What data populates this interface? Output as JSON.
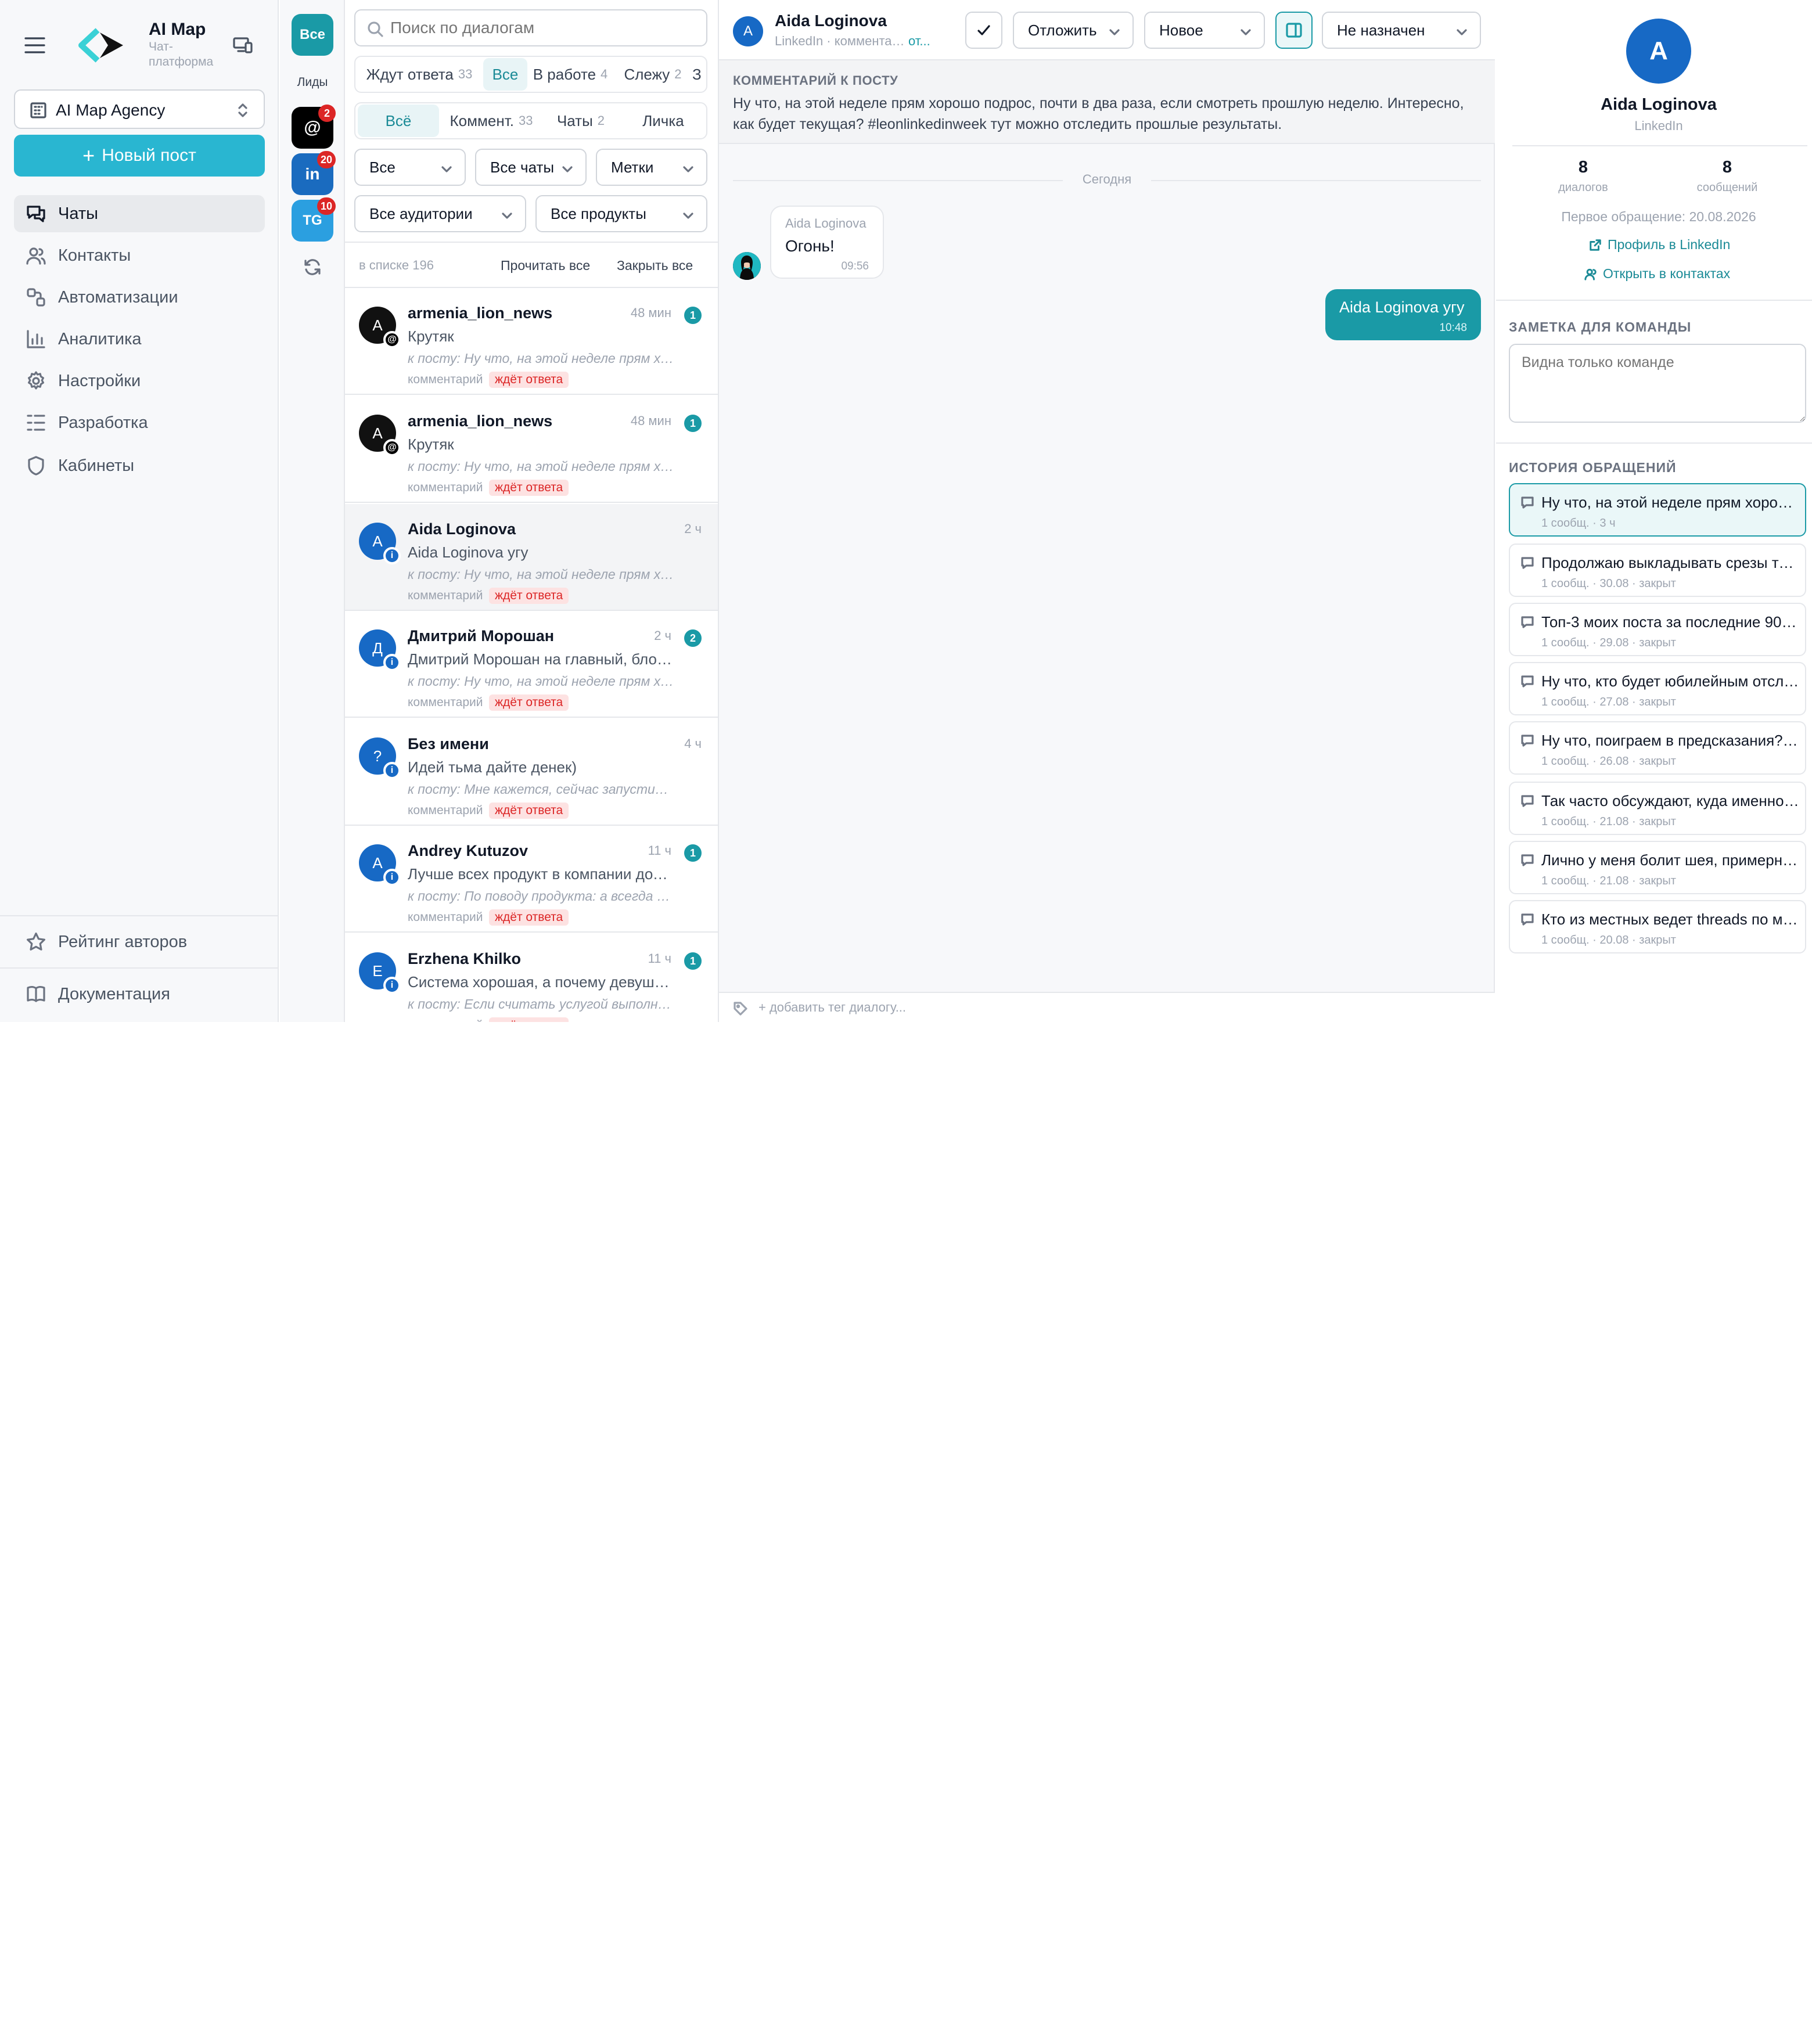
{
  "app": {
    "name": "AI Map",
    "subtitle": "Чат-платформа",
    "workspace": "AI Map Agency",
    "new_post": "Новый пост"
  },
  "nav": [
    {
      "label": "Чаты",
      "icon": "chat-icon",
      "active": true
    },
    {
      "label": "Контакты",
      "icon": "users-icon"
    },
    {
      "label": "Автоматизации",
      "icon": "automation-icon"
    },
    {
      "label": "Аналитика",
      "icon": "analytics-icon"
    },
    {
      "label": "Настройки",
      "icon": "gear-icon"
    },
    {
      "label": "Разработка",
      "icon": "list-icon"
    },
    {
      "label": "Кабинеты",
      "icon": "shield-icon"
    }
  ],
  "nav_bottom": [
    {
      "label": "Рейтинг авторов",
      "icon": "star-icon"
    },
    {
      "label": "Документация",
      "icon": "book-icon"
    }
  ],
  "rail": {
    "all_label": "Все",
    "leads_label": "Лиды",
    "channels": [
      {
        "label": "@",
        "badge": "2",
        "color": "#000000",
        "icon": "threads-icon"
      },
      {
        "label": "in",
        "badge": "20",
        "color": "#1a6bbf",
        "icon": "linkedin-icon"
      },
      {
        "label": "TG",
        "badge": "10",
        "color": "#2b9fe0",
        "icon": "telegram-icon"
      }
    ]
  },
  "list": {
    "search_placeholder": "Поиск по диалогам",
    "status_tabs": [
      {
        "label": "Ждут ответа",
        "count": "33"
      },
      {
        "label": "Все",
        "count": "",
        "active": true
      },
      {
        "label": "В работе",
        "count": "4"
      },
      {
        "label": "Слежу",
        "count": "2"
      },
      {
        "label": "З",
        "count": ""
      }
    ],
    "type_tabs": [
      {
        "label": "Всё",
        "count": "",
        "active": true
      },
      {
        "label": "Коммент.",
        "count": "33"
      },
      {
        "label": "Чаты",
        "count": "2"
      },
      {
        "label": "Личка",
        "count": ""
      }
    ],
    "filters": [
      "Все",
      "Все чаты",
      "Метки",
      "Все аудитории",
      "Все продукты"
    ],
    "count_text": "в списке 196",
    "read_all": "Прочитать все",
    "close_all": "Закрыть все",
    "conversations": [
      {
        "avatar": "A",
        "av_color": "#111111",
        "sub": "@",
        "sub_color": "#000000",
        "name": "armenia_lion_news",
        "time": "48 мин",
        "unread": "1",
        "preview": "Крутяк",
        "post": "к посту: Ну что, на этой неделе прям хорошо подрос",
        "type": "комментарий",
        "status": "ждёт ответа"
      },
      {
        "avatar": "A",
        "av_color": "#111111",
        "sub": "@",
        "sub_color": "#000000",
        "name": "armenia_lion_news",
        "time": "48 мин",
        "unread": "1",
        "preview": "Крутяк",
        "post": "к посту: Ну что, на этой неделе прям хорошо подрос",
        "type": "комментарий",
        "status": "ждёт ответа"
      },
      {
        "avatar": "A",
        "av_color": "#1769c5",
        "sub": "i",
        "sub_color": "#1769c5",
        "name": "Aida Loginova",
        "time": "2 ч",
        "unread": "",
        "preview": "Aida Loginova угу",
        "post": "к посту: Ну что, на этой неделе прям хорошо подрос",
        "type": "комментарий",
        "status": "ждёт ответа",
        "selected": true
      },
      {
        "avatar": "Д",
        "av_color": "#1769c5",
        "sub": "i",
        "sub_color": "#1769c5",
        "name": "Дмитрий Морошан",
        "time": "2 ч",
        "unread": "2",
        "preview": "Дмитрий Морошан на главный, блок с кейсами",
        "post": "к посту: Ну что, на этой неделе прям хорошо подрос",
        "type": "комментарий",
        "status": "ждёт ответа"
      },
      {
        "avatar": "?",
        "av_color": "#1769c5",
        "sub": "i",
        "sub_color": "#1769c5",
        "name": "Без имени",
        "time": "4 ч",
        "unread": "",
        "preview": "Идей тьма дайте денек)",
        "post": "к посту: Мне кажется, сейчас запустить стартап",
        "type": "комментарий",
        "status": "ждёт ответа"
      },
      {
        "avatar": "A",
        "av_color": "#1769c5",
        "sub": "i",
        "sub_color": "#1769c5",
        "name": "Andrey Kutuzov",
        "time": "11 ч",
        "unread": "1",
        "preview": "Лучше всех продукт в компании должен знать",
        "post": "к посту: По поводу продукта: а всегда ли нужно",
        "type": "комментарий",
        "status": "ждёт ответа"
      },
      {
        "avatar": "E",
        "av_color": "#1769c5",
        "sub": "i",
        "sub_color": "#1769c5",
        "name": "Erzhena Khilko",
        "time": "11 ч",
        "unread": "1",
        "preview": "Система хорошая, а почему девушка не может",
        "post": "к посту: Если считать услугой выполнение задач",
        "type": "комментарий",
        "status": "ждёт ответа"
      }
    ]
  },
  "chat": {
    "name": "Aida Loginova",
    "avatar": "A",
    "meta": "LinkedIn · комментарий · от",
    "meta_link": "от...",
    "postpone": "Отложить",
    "status": "Новое",
    "assignee": "Не назначен",
    "post_comment_label": "КОММЕНТАРИЙ К ПОСТУ",
    "post_comment": "Ну что, на этой неделе прям хорошо подрос, почти в два раза, если смотреть прошлую неделю. Интересно, как будет текущая? #leonlinkedinweek тут можно отследить прошлые результаты.",
    "day_divider": "Сегодня",
    "messages": [
      {
        "side": "in",
        "author": "Aida Loginova",
        "text": "Огонь!",
        "time": "09:56"
      },
      {
        "side": "out",
        "author": "",
        "text": "Aida Loginova угу",
        "time": "10:48"
      }
    ],
    "tag_placeholder": "+ добавить тег диалогу..."
  },
  "profile": {
    "avatar": "A",
    "name": "Aida Loginova",
    "source": "LinkedIn",
    "dialogs": "8",
    "dialogs_label": "диалогов",
    "messages": "8",
    "messages_label": "сообщений",
    "first_contact": "Первое обращение: 20.08.2026",
    "linkedin_link": "Профиль в LinkedIn",
    "contacts_link": "Открыть в контактах",
    "note_title": "ЗАМЕТКА ДЛЯ КОМАНДЫ",
    "note_placeholder": "Видна только команде",
    "history_title": "ИСТОРИЯ ОБРАЩЕНИЙ",
    "history": [
      {
        "title": "Ну что, на этой неделе прям хорошо подрос",
        "meta": "1 сообщ. · 3 ч",
        "active": true
      },
      {
        "title": "Продолжаю выкладывать срезы тестов",
        "meta": "1 сообщ. · 30.08 · закрыт"
      },
      {
        "title": "Топ-3 моих поста за последние 90 дней",
        "meta": "1 сообщ. · 29.08 · закрыт"
      },
      {
        "title": "Ну что, кто будет юбилейным отслеживать",
        "meta": "1 сообщ. · 27.08 · закрыт"
      },
      {
        "title": "Ну что, поиграем в предсказания? Кто",
        "meta": "1 сообщ. · 26.08 · закрыт"
      },
      {
        "title": "Так часто обсуждают, куда именно стоит",
        "meta": "1 сообщ. · 21.08 · закрыт"
      },
      {
        "title": "Лично у меня болит шея, примерно раз в",
        "meta": "1 сообщ. · 21.08 · закрыт"
      },
      {
        "title": "Кто из местных ведет threads по ми...",
        "meta": "1 сообщ. · 20.08 · закрыт"
      }
    ]
  },
  "colors": {
    "accent": "#1a9aa6",
    "new_post": "#29b6d1",
    "linkedin": "#1769c5",
    "alert": "#dc2626"
  }
}
